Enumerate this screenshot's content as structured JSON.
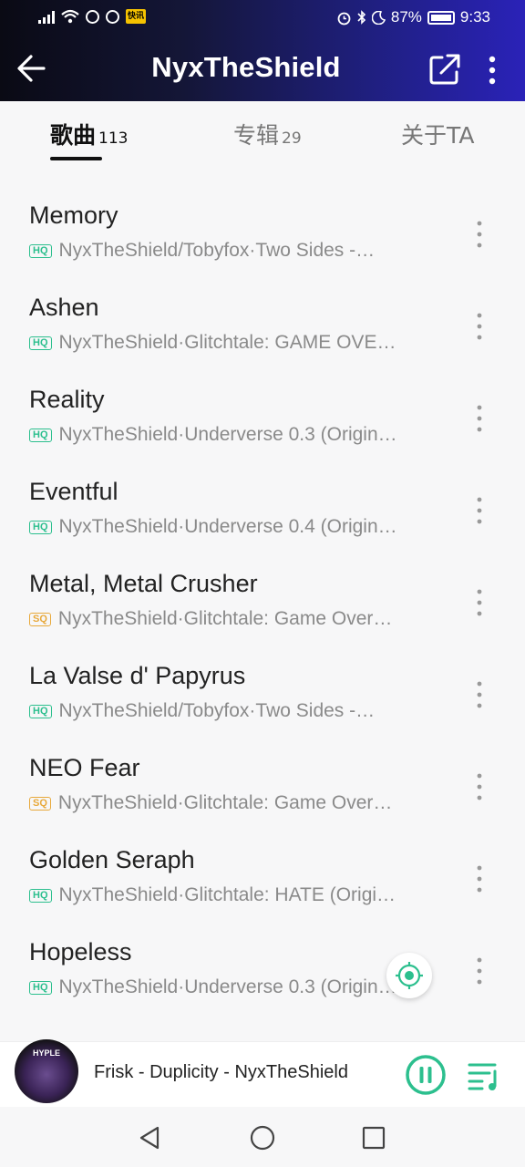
{
  "status": {
    "battery": "87%",
    "time": "9:33",
    "app_badge": "快讯"
  },
  "appbar": {
    "title": "NyxTheShield",
    "back_icon": "arrow-left-icon",
    "share_icon": "share-icon",
    "more_icon": "more-vertical-icon"
  },
  "tabs": [
    {
      "label": "歌曲",
      "count": "113"
    },
    {
      "label": "专辑",
      "count": "29"
    },
    {
      "label": "关于TA",
      "count": ""
    }
  ],
  "songs": [
    {
      "title": "Memory",
      "quality": "HQ",
      "artist": "NyxTheShield/Tobyfox·Two Sides -…"
    },
    {
      "title": "Ashen",
      "quality": "HQ",
      "artist": "NyxTheShield·Glitchtale: GAME OVE…"
    },
    {
      "title": "Reality",
      "quality": "HQ",
      "artist": "NyxTheShield·Underverse 0.3 (Origin…"
    },
    {
      "title": "Eventful",
      "quality": "HQ",
      "artist": "NyxTheShield·Underverse 0.4 (Origin…"
    },
    {
      "title": "Metal, Metal Crusher",
      "quality": "SQ",
      "artist": "NyxTheShield·Glitchtale: Game Over…"
    },
    {
      "title": "La Valse d' Papyrus",
      "quality": "HQ",
      "artist": "NyxTheShield/Tobyfox·Two Sides -…"
    },
    {
      "title": "NEO Fear",
      "quality": "SQ",
      "artist": "NyxTheShield·Glitchtale: Game Over…"
    },
    {
      "title": "Golden Seraph",
      "quality": "HQ",
      "artist": "NyxTheShield·Glitchtale: HATE (Origi…"
    },
    {
      "title": "Hopeless",
      "quality": "HQ",
      "artist": "NyxTheShield·Underverse 0.3 (Origin…"
    }
  ],
  "player": {
    "now_playing": "Frisk - Duplicity - NyxTheShield",
    "cover_text": "HYPLE",
    "state": "playing"
  },
  "colors": {
    "accent": "#2cbf8e",
    "sq": "#e8a93b",
    "header_start": "#0a0a14",
    "header_end": "#2a22b8"
  }
}
